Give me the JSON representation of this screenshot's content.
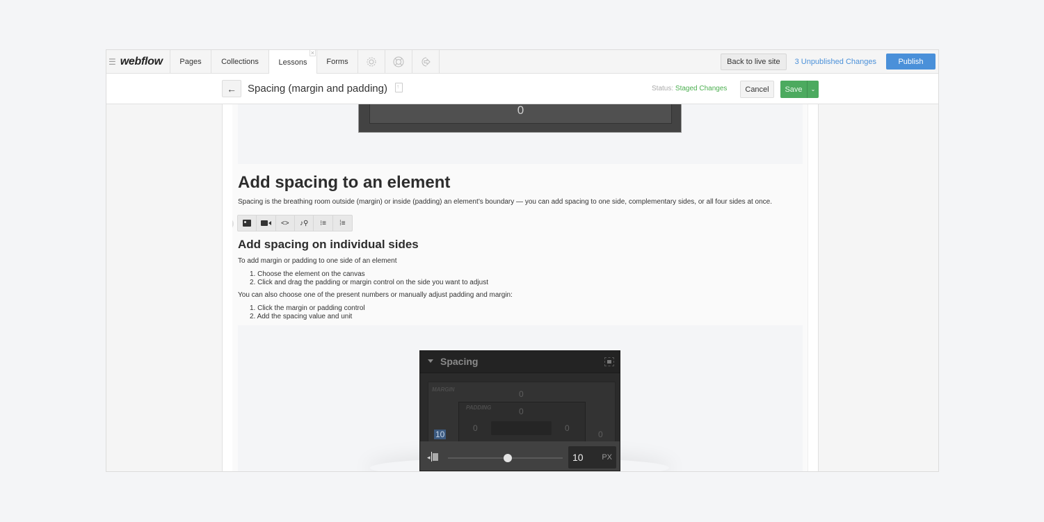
{
  "topbar": {
    "brand": "webflow",
    "tabs": [
      {
        "label": "Pages"
      },
      {
        "label": "Collections"
      },
      {
        "label": "Lessons",
        "active": true,
        "close": "×"
      },
      {
        "label": "Forms"
      }
    ],
    "icon_tabs": [
      "gear-icon",
      "lifebuoy-icon",
      "logout-icon"
    ],
    "back_to_live": "Back to live site",
    "unpublished": "3 Unpublished Changes",
    "publish": "Publish"
  },
  "editbar": {
    "back_arrow": "←",
    "title": "Spacing (margin and padding)",
    "status_label": "Status:",
    "status_value": "Staged Changes",
    "cancel": "Cancel",
    "save": "Save",
    "save_dropdown": "⌄"
  },
  "content": {
    "figure_top_value": "0",
    "heading1": "Add spacing to an element",
    "intro": "Spacing is the breathing room outside (margin) or inside (padding) an element’s boundary — you can add spacing to one side, complementary sides, or all four sides at once.",
    "toolbar": {
      "close": "×",
      "buttons": [
        "image",
        "video",
        "code",
        "media",
        "bulleted-list",
        "numbered-list"
      ],
      "code_glyph": "<>",
      "media_glyph": "♪⚲",
      "ul_glyph": "⁝≡",
      "ol_glyph": "⁞≡"
    },
    "heading2": "Add spacing on individual sides",
    "p1": "To add margin or padding to one side of an element",
    "list1": [
      "1. Choose the element on the canvas",
      "2. Click and drag the padding or margin control on the side you want to adjust"
    ],
    "p2": "You can also choose one of the present numbers or manually adjust padding and margin:",
    "list2": [
      "1. Click the margin or padding control",
      "2. Add the spacing value and unit"
    ]
  },
  "spacing_panel": {
    "title": "Spacing",
    "margin_label": "MARGIN",
    "padding_label": "PADDING",
    "margin": {
      "top": "0",
      "left": "10",
      "right": "0"
    },
    "padding": {
      "top": "0",
      "left": "0",
      "right": "0"
    },
    "slider_fraction": 0.52,
    "value": "10",
    "unit": "PX"
  }
}
